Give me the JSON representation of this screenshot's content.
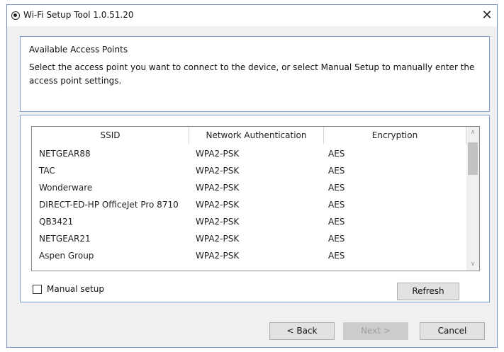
{
  "window": {
    "title": "Wi-Fi Setup Tool 1.0.51.20",
    "close_glyph": "✕"
  },
  "header": {
    "title": "Available Access Points",
    "description": "Select the access point you want to connect to the device, or select Manual Setup to manually enter the access point settings."
  },
  "table": {
    "columns": [
      "SSID",
      "Network Authentication",
      "Encryption"
    ],
    "rows": [
      [
        "NETGEAR88",
        "WPA2-PSK",
        "AES"
      ],
      [
        "TAC",
        "WPA2-PSK",
        "AES"
      ],
      [
        "Wonderware",
        "WPA2-PSK",
        "AES"
      ],
      [
        "DIRECT-ED-HP OfficeJet Pro 8710",
        "WPA2-PSK",
        "AES"
      ],
      [
        "QB3421",
        "WPA2-PSK",
        "AES"
      ],
      [
        "NETGEAR21",
        "WPA2-PSK",
        "AES"
      ],
      [
        "Aspen Group",
        "WPA2-PSK",
        "AES"
      ]
    ],
    "scroll_up_glyph": "∧",
    "scroll_down_glyph": "∨"
  },
  "manual_setup": {
    "label": "Manual setup",
    "checked": false
  },
  "buttons": {
    "refresh": "Refresh",
    "back": "< Back",
    "next": "Next >",
    "cancel": "Cancel"
  },
  "icons": {
    "app": "app-logo-icon",
    "close": "close-icon",
    "scroll_up": "chevron-up-icon",
    "scroll_down": "chevron-down-icon"
  },
  "colors": {
    "panel_border": "#7aa1cf",
    "window_bg": "#f0f0f0",
    "button_bg": "#e1e1e1"
  }
}
